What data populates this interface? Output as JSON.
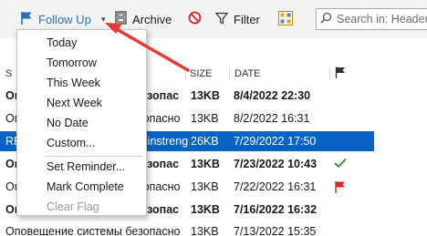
{
  "toolbar": {
    "follow_up_label": "Follow Up",
    "archive_label": "Archive",
    "filter_label": "Filter"
  },
  "search": {
    "placeholder": "Search in: Headers"
  },
  "columns": {
    "from": "S",
    "size": "SIZE",
    "date": "DATE"
  },
  "menu": {
    "items": [
      {
        "label": "Today",
        "enabled": true
      },
      {
        "label": "Tomorrow",
        "enabled": true
      },
      {
        "label": "This Week",
        "enabled": true
      },
      {
        "label": "Next Week",
        "enabled": true
      },
      {
        "label": "No Date",
        "enabled": true
      },
      {
        "label": "Custom...",
        "enabled": true
      },
      {
        "label": "Set Reminder...",
        "enabled": true
      },
      {
        "label": "Mark Complete",
        "enabled": true
      },
      {
        "label": "Clear Flag",
        "enabled": false
      }
    ]
  },
  "messages": [
    {
      "from": "Оповещение системы безопас",
      "size": "13KB",
      "date": "8/4/2022 22:30",
      "unread": true,
      "selected": false,
      "flag": ""
    },
    {
      "from": "Оповещение системы безопасно",
      "size": "13KB",
      "date": "8/2/2022 16:31",
      "unread": false,
      "selected": false,
      "flag": ""
    },
    {
      "from": "RE: Оповещение системы instreng",
      "size": "26KB",
      "date": "7/29/2022 17:50",
      "unread": false,
      "selected": true,
      "flag": ""
    },
    {
      "from": "Оповещение системы безопас",
      "size": "13KB",
      "date": "7/23/2022 10:43",
      "unread": true,
      "selected": false,
      "flag": "complete"
    },
    {
      "from": "Оповещение системы безопасно",
      "size": "13KB",
      "date": "7/22/2022 16:31",
      "unread": false,
      "selected": false,
      "flag": "flagged"
    },
    {
      "from": "Оповещение системы безопас",
      "size": "13KB",
      "date": "7/16/2022 16:32",
      "unread": true,
      "selected": false,
      "flag": ""
    },
    {
      "from": "Оповещение системы безопасно",
      "size": "13KB",
      "date": "7/13/2022 15:35",
      "unread": false,
      "selected": false,
      "flag": ""
    }
  ],
  "colors": {
    "accent": "#2a6fb5",
    "selection": "#0a64c8",
    "flag_red": "#d9262a",
    "check_green": "#2a8a3a",
    "annotation_arrow": "#e23b3b"
  },
  "icons": [
    "flag-icon",
    "chevron-down-icon",
    "archive-icon",
    "block-icon",
    "filter-icon",
    "people-icon",
    "search-icon",
    "column-flag-icon",
    "check-icon",
    "red-flag-icon"
  ]
}
